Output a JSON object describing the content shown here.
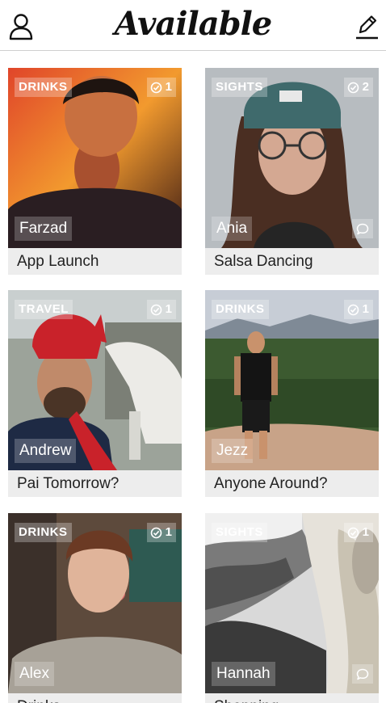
{
  "header": {
    "title": "Available",
    "profile_icon": "person-icon",
    "compose_icon": "pencil-edit-icon"
  },
  "cards": [
    {
      "category": "DRINKS",
      "count": "1",
      "name": "Farzad",
      "caption": "App Launch",
      "has_chat": false
    },
    {
      "category": "SIGHTS",
      "count": "2",
      "name": "Ania",
      "caption": "Salsa Dancing",
      "has_chat": true
    },
    {
      "category": "TRAVEL",
      "count": "1",
      "name": "Andrew",
      "caption": "Pai Tomorrow?",
      "has_chat": false
    },
    {
      "category": "DRINKS",
      "count": "1",
      "name": "Jezz",
      "caption": "Anyone Around?",
      "has_chat": false
    },
    {
      "category": "DRINKS",
      "count": "1",
      "name": "Alex",
      "caption": "Drinks",
      "has_chat": false
    },
    {
      "category": "SIGHTS",
      "count": "1",
      "name": "Hannah",
      "caption": "Shopping",
      "has_chat": true
    }
  ],
  "icons": {
    "count_icon": "check-circle-icon",
    "chat_icon": "speech-bubble-icon"
  },
  "colors": {
    "caption_bg": "#ededed",
    "header_border": "#cfcfcf"
  }
}
